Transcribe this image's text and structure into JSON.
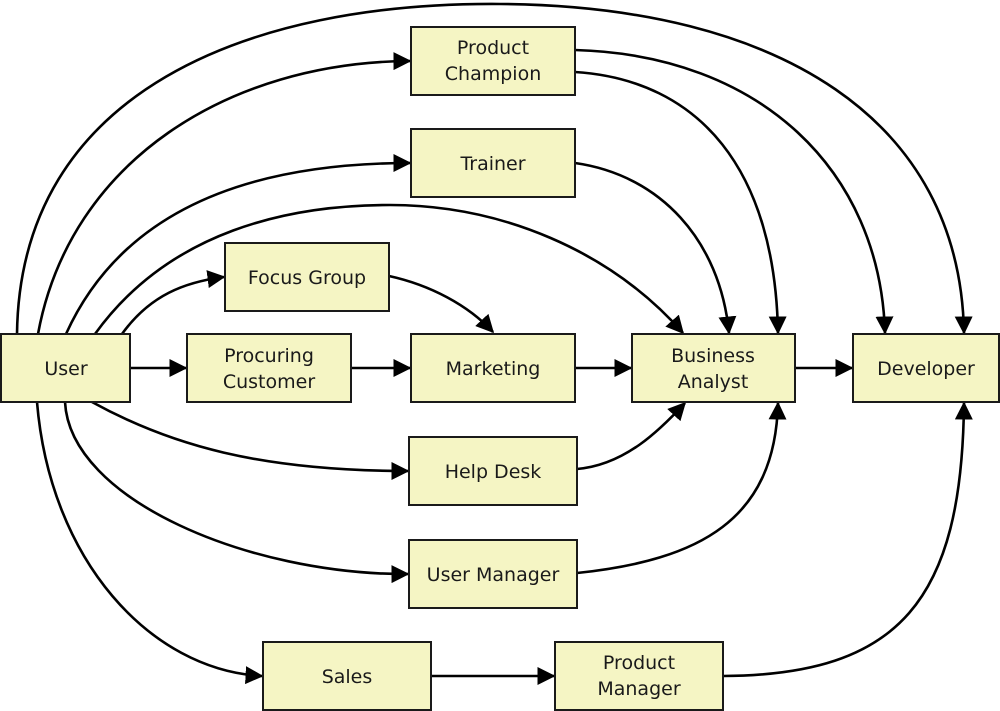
{
  "diagram": {
    "title": "",
    "box_fill": "#f5f5c4",
    "line_color": "#000000",
    "nodes": {
      "user": [
        "User"
      ],
      "procuring_customer": [
        "Procuring",
        "Customer"
      ],
      "marketing": [
        "Marketing"
      ],
      "business_analyst": [
        "Business",
        "Analyst"
      ],
      "developer": [
        "Developer"
      ],
      "product_champion": [
        "Product",
        "Champion"
      ],
      "trainer": [
        "Trainer"
      ],
      "focus_group": [
        "Focus Group"
      ],
      "help_desk": [
        "Help Desk"
      ],
      "user_manager": [
        "User Manager"
      ],
      "sales": [
        "Sales"
      ],
      "product_manager": [
        "Product",
        "Manager"
      ]
    },
    "edges": [
      {
        "from": "User",
        "to": "Procuring Customer"
      },
      {
        "from": "Procuring Customer",
        "to": "Marketing"
      },
      {
        "from": "Marketing",
        "to": "Business Analyst"
      },
      {
        "from": "Business Analyst",
        "to": "Developer"
      },
      {
        "from": "User",
        "to": "Focus Group"
      },
      {
        "from": "Focus Group",
        "to": "Marketing"
      },
      {
        "from": "User",
        "to": "Trainer"
      },
      {
        "from": "Trainer",
        "to": "Business Analyst"
      },
      {
        "from": "User",
        "to": "Product Champion"
      },
      {
        "from": "Product Champion",
        "to": "Business Analyst"
      },
      {
        "from": "Product Champion",
        "to": "Developer"
      },
      {
        "from": "User",
        "to": "Business Analyst"
      },
      {
        "from": "User",
        "to": "Developer"
      },
      {
        "from": "User",
        "to": "Help Desk"
      },
      {
        "from": "Help Desk",
        "to": "Business Analyst"
      },
      {
        "from": "User",
        "to": "User Manager"
      },
      {
        "from": "User Manager",
        "to": "Business Analyst"
      },
      {
        "from": "User",
        "to": "Sales"
      },
      {
        "from": "Sales",
        "to": "Product Manager"
      },
      {
        "from": "Product Manager",
        "to": "Developer"
      }
    ]
  }
}
